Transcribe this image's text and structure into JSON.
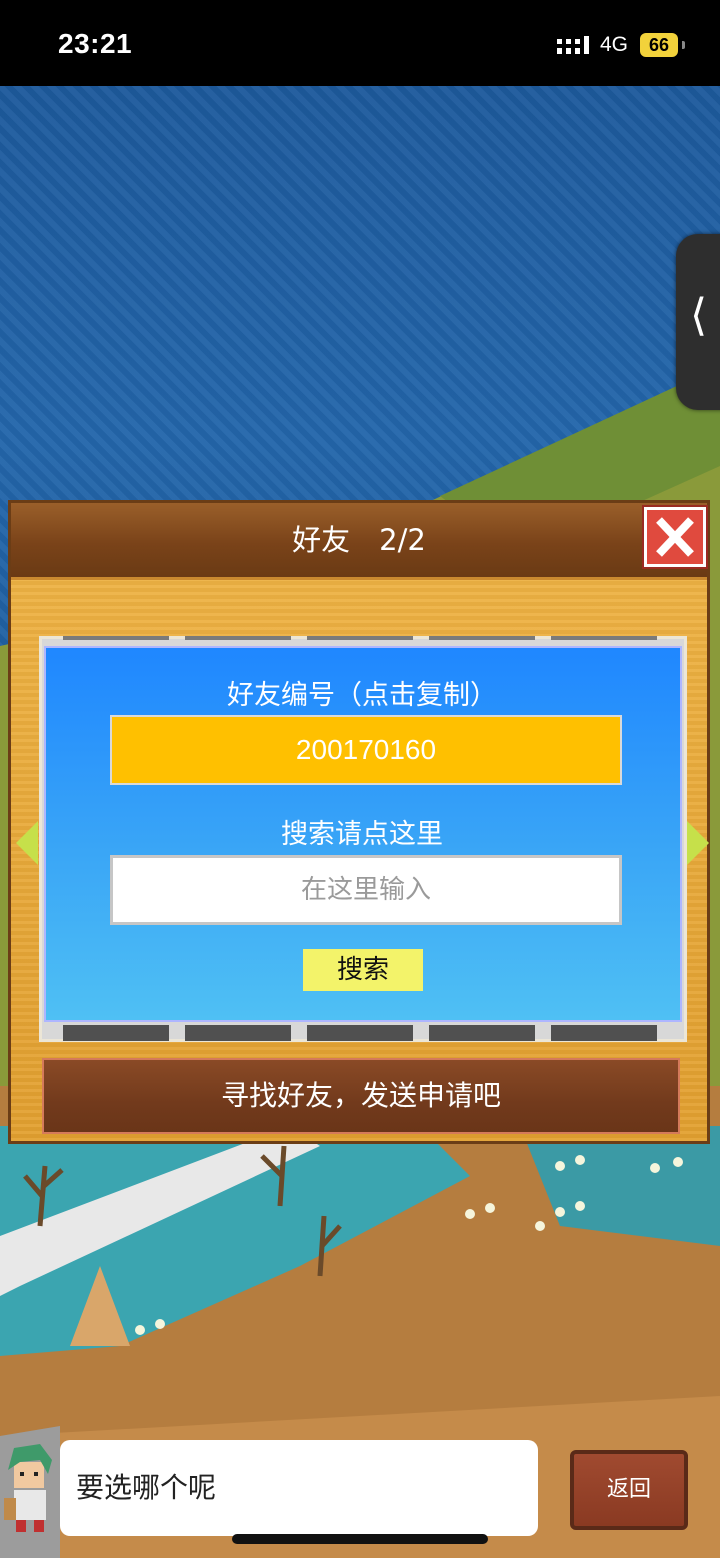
{
  "status_bar": {
    "time": "23:21",
    "network": "4G",
    "battery": "66"
  },
  "side_handle": {
    "glyph": "⟨"
  },
  "panel": {
    "title": "好友　2/2",
    "friend_id_label": "好友编号（点击复制）",
    "friend_id": "200170160",
    "search_label": "搜索请点这里",
    "search_placeholder": "在这里输入",
    "search_button": "搜索",
    "bottom_button": "寻找好友，发送申请吧"
  },
  "dialog": {
    "text": "要选哪个呢"
  },
  "back_button": "返回",
  "colors": {
    "sea": "#2366ab",
    "panel": "#e8ab3c",
    "card": "#1f87ff",
    "id_box": "#ffc000",
    "search_button": "#f3f36a",
    "close_button": "#e04a3e"
  }
}
